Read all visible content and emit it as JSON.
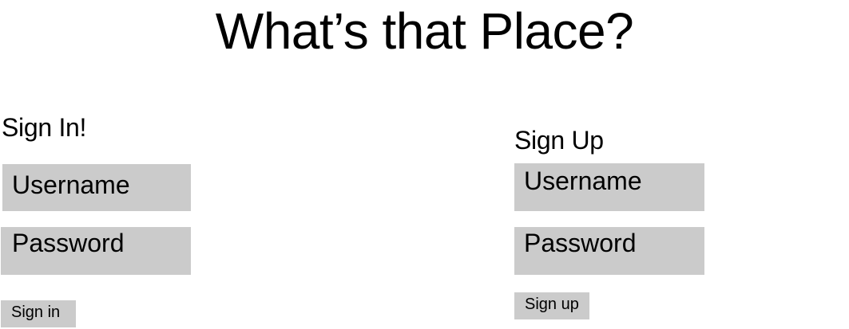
{
  "app": {
    "title": "What’s that Place?"
  },
  "sign_in": {
    "heading": "Sign In!",
    "username_placeholder": "Username",
    "password_placeholder": "Password",
    "button_label": "Sign in"
  },
  "sign_up": {
    "heading": "Sign Up",
    "username_placeholder": "Username",
    "password_placeholder": "Password",
    "button_label": "Sign up"
  },
  "colors": {
    "field_background": "#cbcbcb",
    "text": "#000000",
    "page_background": "#ffffff"
  }
}
